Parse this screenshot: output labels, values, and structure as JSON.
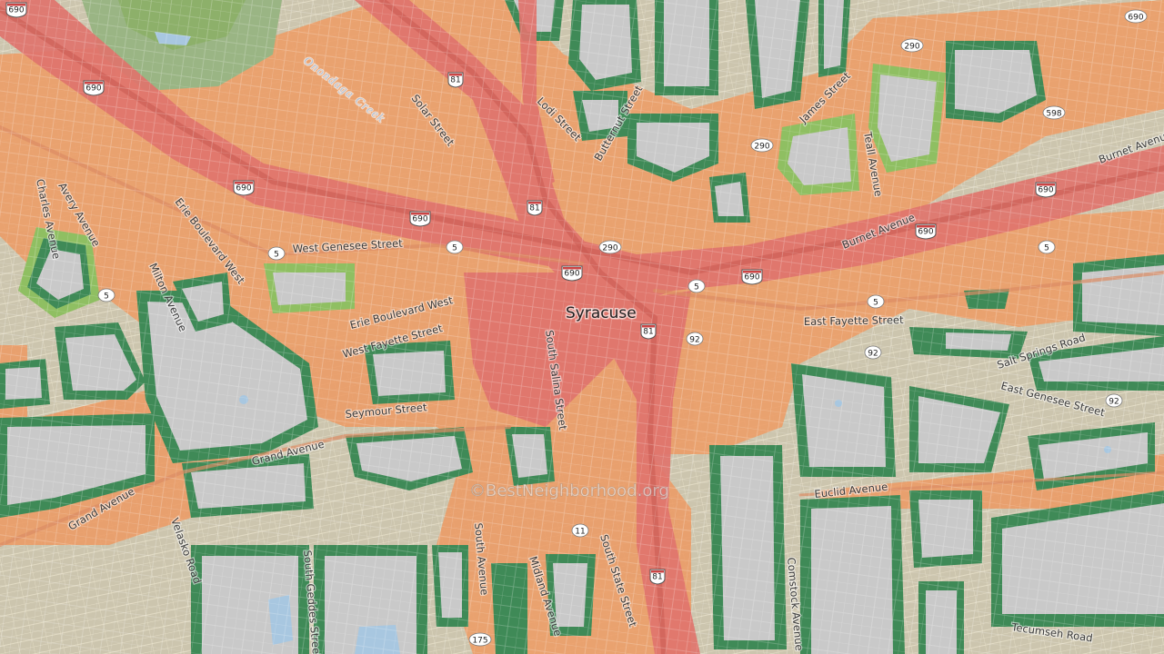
{
  "city": "Syracuse",
  "watermark": "©BestNeighborhood.org",
  "water": [
    "Onondaga Creek"
  ],
  "streets": [
    "Solar Street",
    "Lodi Street",
    "Butternut Street",
    "James Street",
    "Teall Avenue",
    "Burnet Avenue",
    "Burnet Avenue",
    "Charles Avenue",
    "Avery Avenue",
    "Erie Boulevard West",
    "West Genesee Street",
    "Milton Avenue",
    "Erie Boulevard West",
    "West Fayette Street",
    "South Salina Street",
    "East Fayette Street",
    "Salt Springs Road",
    "East Genesee Street",
    "Seymour Street",
    "Grand Avenue",
    "Grand Avenue",
    "Velasko Road",
    "South Geddes Street",
    "South Avenue",
    "Midland Avenue",
    "South State Street",
    "Euclid Avenue",
    "Comstock Avenue",
    "Tecumseh Road"
  ],
  "shields": [
    {
      "type": "interstate",
      "num": "690"
    },
    {
      "type": "interstate",
      "num": "690"
    },
    {
      "type": "interstate",
      "num": "81"
    },
    {
      "type": "interstate",
      "num": "690"
    },
    {
      "type": "interstate",
      "num": "81"
    },
    {
      "type": "interstate",
      "num": "690"
    },
    {
      "type": "interstate",
      "num": "690"
    },
    {
      "type": "interstate",
      "num": "690"
    },
    {
      "type": "interstate",
      "num": "690"
    },
    {
      "type": "interstate",
      "num": "690"
    },
    {
      "type": "interstate",
      "num": "81"
    },
    {
      "type": "interstate",
      "num": "81"
    },
    {
      "type": "state",
      "num": "690"
    },
    {
      "type": "state",
      "num": "290"
    },
    {
      "type": "state",
      "num": "290"
    },
    {
      "type": "state",
      "num": "290"
    },
    {
      "type": "state",
      "num": "598"
    },
    {
      "type": "state",
      "num": "5"
    },
    {
      "type": "state",
      "num": "5"
    },
    {
      "type": "state",
      "num": "5"
    },
    {
      "type": "state",
      "num": "5"
    },
    {
      "type": "state",
      "num": "5"
    },
    {
      "type": "state",
      "num": "5"
    },
    {
      "type": "state",
      "num": "92"
    },
    {
      "type": "state",
      "num": "92"
    },
    {
      "type": "state",
      "num": "92"
    },
    {
      "type": "state",
      "num": "11"
    },
    {
      "type": "state",
      "num": "175"
    }
  ],
  "colors": {
    "highest": "#e0746d",
    "high": "#ec9d68",
    "moderate": "#d9ba5e",
    "low": "#8fbf62",
    "lowest": "#3f8a57",
    "base": "#c9c9c9"
  }
}
